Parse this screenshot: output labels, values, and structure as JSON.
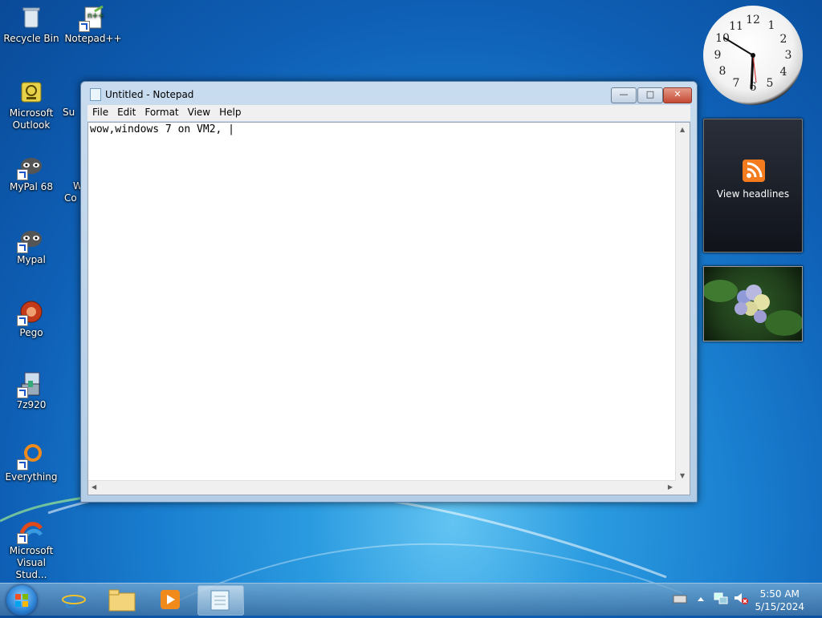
{
  "desktop": {
    "icons": [
      {
        "label": "Recycle Bin"
      },
      {
        "label": "Notepad++"
      },
      {
        "label": "Microsoft Outlook"
      },
      {
        "label": "MyPal 68"
      },
      {
        "label": "Mypal"
      },
      {
        "label": "Pego"
      },
      {
        "label": "7z920"
      },
      {
        "label": "Everything"
      },
      {
        "label": "Microsoft Visual Stud..."
      }
    ],
    "partial_labels": [
      "Su",
      "W",
      "Co"
    ]
  },
  "gadgets": {
    "clock_numbers": [
      "12",
      "1",
      "2",
      "3",
      "4",
      "5",
      "6",
      "7",
      "8",
      "9",
      "10",
      "11"
    ],
    "feed_label": "View headlines"
  },
  "window": {
    "title": "Untitled - Notepad",
    "menu": [
      "File",
      "Edit",
      "Format",
      "View",
      "Help"
    ],
    "content": "wow,windows 7 on VM2, |",
    "buttons": {
      "minimize": "—",
      "maximize": "□",
      "close": "✕"
    }
  },
  "taskbar": {
    "time": "5:50 AM",
    "date": "5/15/2024"
  }
}
